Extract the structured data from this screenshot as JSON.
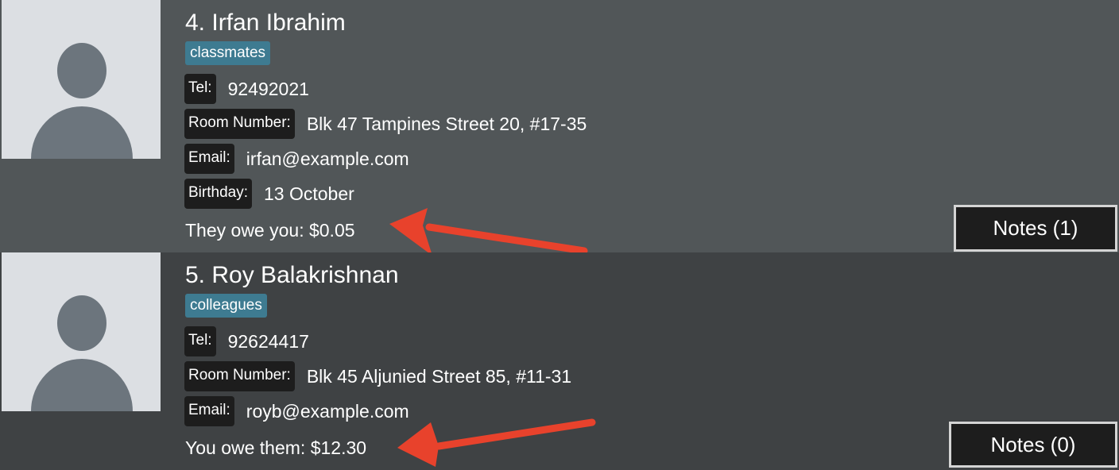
{
  "persons": [
    {
      "index": "4.",
      "name": "Irfan Ibrahim",
      "tag": "classmates",
      "tel_label": "Tel:",
      "tel": "92492021",
      "room_label": "Room Number:",
      "room": "Blk 47 Tampines Street 20, #17-35",
      "email_label": "Email:",
      "email": "irfan@example.com",
      "birthday_label": "Birthday:",
      "birthday": "13 October",
      "debt": "They owe you: $0.05",
      "notes_button": "Notes (1)"
    },
    {
      "index": "5.",
      "name": "Roy Balakrishnan",
      "tag": "colleagues",
      "tel_label": "Tel:",
      "tel": "92624417",
      "room_label": "Room Number:",
      "room": "Blk 45 Aljunied Street 85, #11-31",
      "email_label": "Email:",
      "email": "royb@example.com",
      "debt": "You owe them: $12.30",
      "notes_button": "Notes (0)"
    }
  ],
  "colors": {
    "card_selected_bg": "#515658",
    "card_bg": "#3f4244",
    "tag_bg": "#3e7b91",
    "label_bg": "#1d1d1d",
    "annotation_arrow": "#e8422c"
  },
  "icons": {
    "avatar": "person-placeholder-icon",
    "annotation": "red-arrow-icon"
  }
}
